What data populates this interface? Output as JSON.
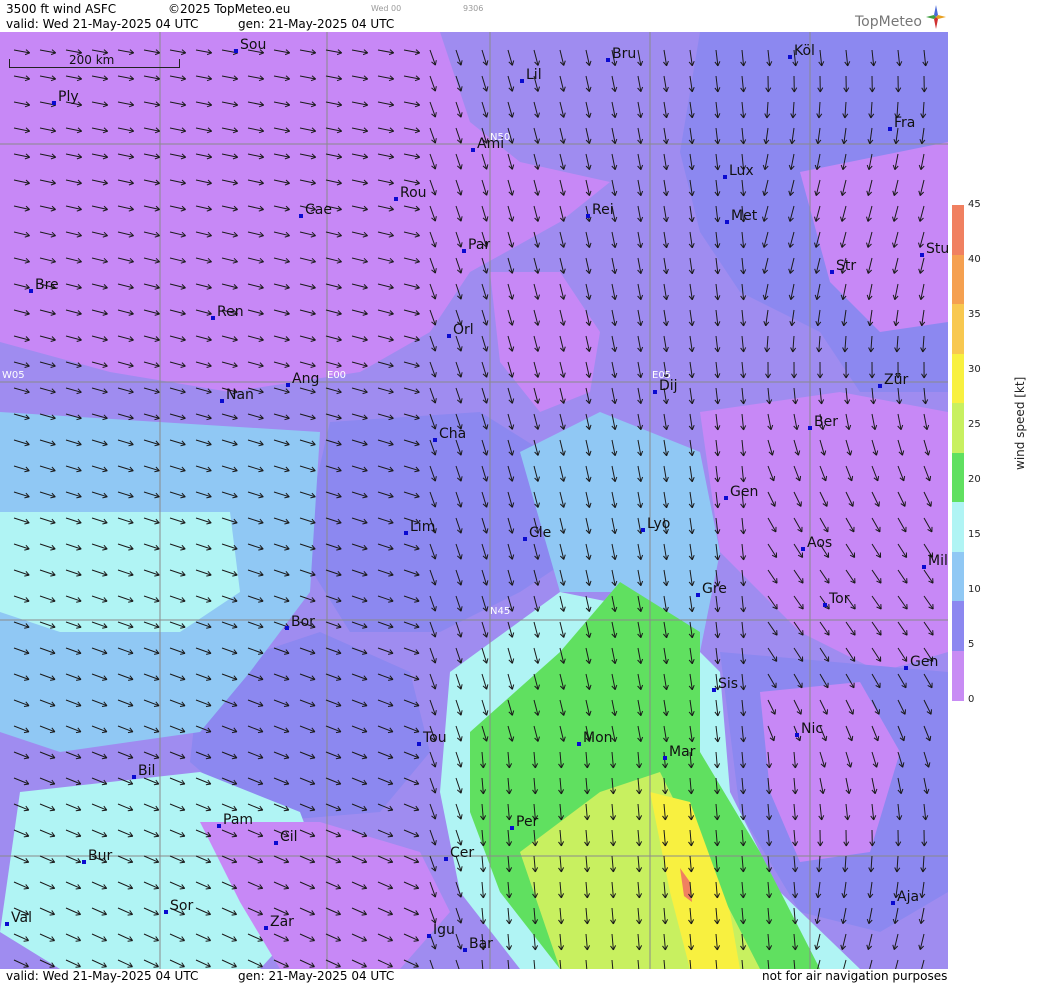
{
  "header": {
    "title": "3500 ft wind ASFC",
    "copyright": "©2025 TopMeteo.eu",
    "valid": "valid:  Wed  21-May-2025  04 UTC",
    "gen": "gen: 21-May-2025 04 UTC",
    "small_day": "Wed 00",
    "small_code": "9306"
  },
  "logo": {
    "text": "TopMeteo",
    "icon": "compass-star-icon"
  },
  "footer": {
    "valid": "valid:  Wed  21-May-2025  04 UTC",
    "gen": "gen: 21-May-2025 04 UTC",
    "note": "not for air navigation purposes"
  },
  "scale_bar": {
    "label": "200 km"
  },
  "grid_labels": [
    "N50",
    "W05",
    "E00",
    "E05",
    "N45"
  ],
  "cities": [
    "Sou",
    "Bru",
    "Köl",
    "Lil",
    "Ply",
    "Fra",
    "Ami",
    "Lux",
    "Rou",
    "Cae",
    "Rei",
    "Met",
    "Par",
    "Stu",
    "Str",
    "Bre",
    "Ren",
    "Orl",
    "Ang",
    "Nan",
    "Dij",
    "Zür",
    "Ber",
    "Cha",
    "Gen",
    "Lim",
    "Cle",
    "Lyo",
    "Aos",
    "Mil",
    "Gre",
    "Tor",
    "Bor",
    "Sis",
    "Gen",
    "Nic",
    "Tou",
    "Mon",
    "Mar",
    "Bil",
    "Pam",
    "Cil",
    "Per",
    "Cer",
    "Bur",
    "Aja",
    "Sor",
    "Val",
    "Zar",
    "Igu",
    "Bar"
  ],
  "legend": {
    "unit": "wind  speed  [kt]",
    "ticks": [
      "45",
      "40",
      "35",
      "30",
      "25",
      "20",
      "15",
      "10",
      "5",
      "0"
    ],
    "colors": [
      "#f08060",
      "#f5a050",
      "#f8c850",
      "#f8f040",
      "#c8f060",
      "#60e060",
      "#b0f4f4",
      "#90c8f4",
      "#8c88f0",
      "#c88cf4"
    ]
  }
}
